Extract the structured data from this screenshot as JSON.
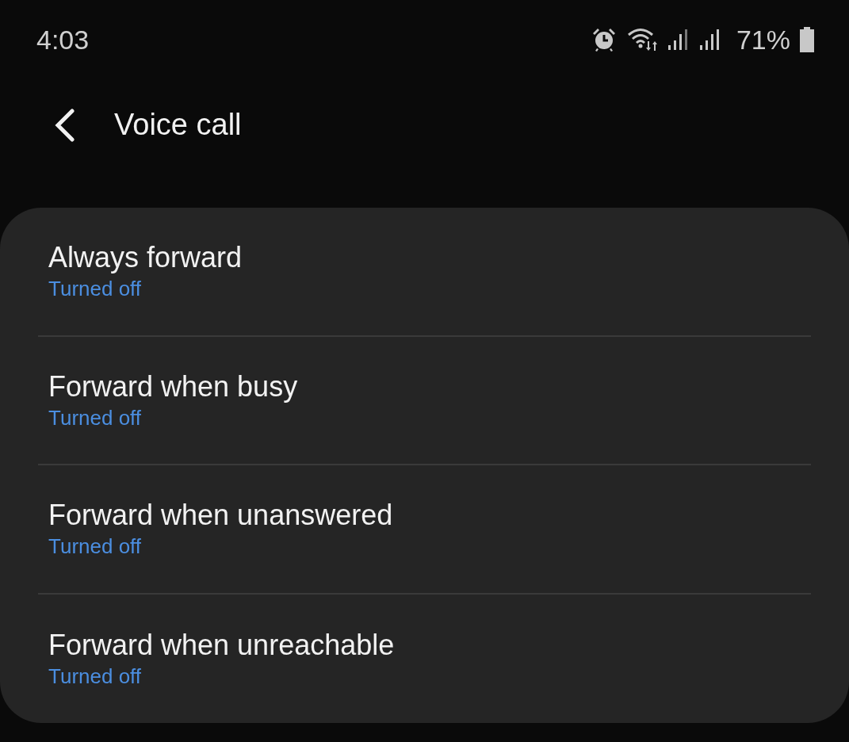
{
  "status_bar": {
    "time": "4:03",
    "battery": "71%"
  },
  "header": {
    "title": "Voice call"
  },
  "items": [
    {
      "title": "Always forward",
      "status": "Turned off"
    },
    {
      "title": "Forward when busy",
      "status": "Turned off"
    },
    {
      "title": "Forward when unanswered",
      "status": "Turned off"
    },
    {
      "title": "Forward when unreachable",
      "status": "Turned off"
    }
  ]
}
